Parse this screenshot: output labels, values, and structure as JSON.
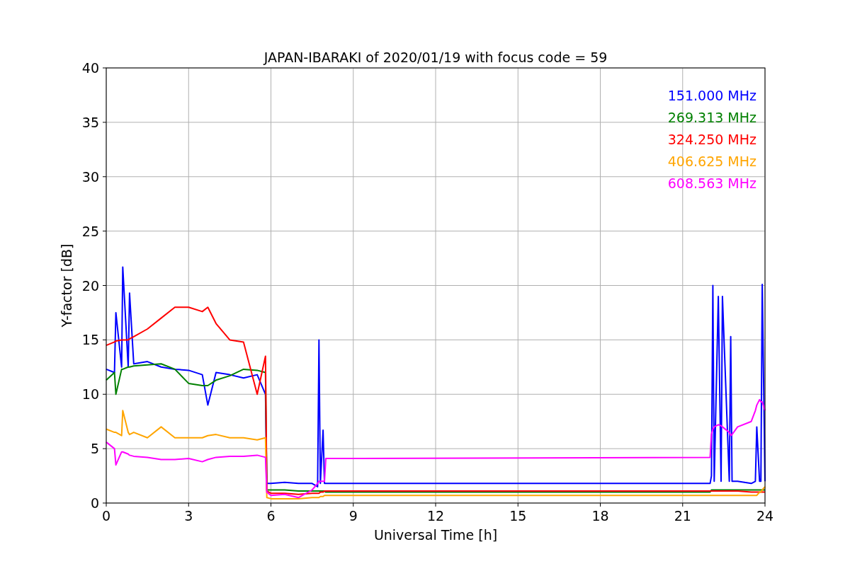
{
  "chart_data": {
    "type": "line",
    "title": "JAPAN-IBARAKI of 2020/01/19 with focus code = 59",
    "xlabel": "Universal Time [h]",
    "ylabel": "Y-factor [dB]",
    "x": [
      0,
      0.3,
      0.35,
      0.56,
      0.6,
      0.8,
      0.85,
      1,
      1.5,
      2,
      2.5,
      3,
      3.5,
      3.7,
      4,
      4.5,
      5,
      5.5,
      5.8,
      5.85,
      6,
      6.5,
      7,
      7.5,
      7.7,
      7.75,
      7.8,
      7.9,
      7.95,
      8,
      8.5,
      22,
      22.05,
      22.1,
      22.15,
      22.3,
      22.4,
      22.45,
      22.7,
      22.75,
      22.8,
      23,
      23.5,
      23.65,
      23.7,
      23.8,
      23.85,
      23.9,
      24
    ],
    "series": [
      {
        "name": "151.000 MHz",
        "color": "#0000ff",
        "values": [
          12.3,
          12,
          17.5,
          12.5,
          21.7,
          12.5,
          19.3,
          12.8,
          13,
          12.5,
          12.3,
          12.2,
          11.8,
          9,
          12,
          11.8,
          11.5,
          11.8,
          10,
          1.8,
          1.8,
          1.9,
          1.8,
          1.8,
          1.5,
          15,
          1.8,
          6.7,
          1.8,
          1.8,
          1.8,
          1.8,
          2.5,
          20,
          2,
          19,
          2,
          19,
          2,
          15.3,
          2,
          2,
          1.8,
          2,
          7,
          2,
          2,
          20.1,
          2
        ]
      },
      {
        "name": "269.313 MHz",
        "color": "#008000",
        "values": [
          11.3,
          12,
          10,
          12.3,
          12.3,
          12.5,
          12.5,
          12.6,
          12.7,
          12.8,
          12.3,
          11,
          10.8,
          10.8,
          11.3,
          11.7,
          12.3,
          12.2,
          12,
          1.2,
          1.2,
          1.2,
          1.1,
          1.1,
          1.1,
          1.1,
          1.1,
          1.1,
          1.1,
          1,
          1,
          1,
          1.2,
          1.2,
          1.2,
          1.2,
          1.2,
          1.2,
          1.2,
          1.2,
          1.2,
          1.2,
          1.2,
          1.2,
          1.2,
          1.2,
          1.2,
          1.2,
          1.2
        ]
      },
      {
        "name": "324.250 MHz",
        "color": "#ff0000",
        "values": [
          14.5,
          14.8,
          14.9,
          15,
          15,
          15,
          15.1,
          15.3,
          16,
          17,
          18,
          18,
          17.6,
          18,
          16.5,
          15,
          14.8,
          10,
          13.5,
          1.1,
          0.9,
          0.9,
          0.8,
          0.9,
          0.9,
          0.9,
          1,
          1,
          1.1,
          1.1,
          1.1,
          1.1,
          1.1,
          1.1,
          1.1,
          1.1,
          1.1,
          1.1,
          1.1,
          1.1,
          1.1,
          1.1,
          1,
          1,
          1,
          1,
          1,
          1,
          1
        ]
      },
      {
        "name": "406.625 MHz",
        "color": "#ffa500",
        "values": [
          6.8,
          6.5,
          6.5,
          6.2,
          8.5,
          6.5,
          6.3,
          6.5,
          6,
          7,
          6,
          6,
          6,
          6.2,
          6.3,
          6,
          6,
          5.8,
          6,
          0.5,
          0.4,
          0.4,
          0.4,
          0.5,
          0.5,
          0.5,
          0.6,
          0.6,
          0.7,
          0.7,
          0.7,
          0.7,
          0.7,
          0.7,
          0.7,
          0.7,
          0.7,
          0.7,
          0.7,
          0.7,
          0.7,
          0.7,
          0.7,
          0.7,
          0.7,
          1,
          1,
          1.2,
          1.5
        ]
      },
      {
        "name": "608.563 MHz",
        "color": "#ff00ff",
        "values": [
          5.6,
          5,
          3.5,
          4.7,
          4.7,
          4.5,
          4.4,
          4.3,
          4.2,
          4,
          4,
          4.1,
          3.8,
          4,
          4.2,
          4.3,
          4.3,
          4.4,
          4.2,
          1,
          0.7,
          0.8,
          0.5,
          1.2,
          1.8,
          2,
          2,
          2,
          2,
          4.1,
          4.1,
          4.2,
          6.3,
          6.8,
          7,
          7.2,
          7.1,
          7,
          6.5,
          6.2,
          6.3,
          7,
          7.5,
          8.5,
          9,
          9.5,
          9.3,
          9.3,
          8.5
        ]
      }
    ],
    "xlim": [
      0,
      24
    ],
    "ylim": [
      0,
      40
    ],
    "xticks": [
      0,
      3,
      6,
      9,
      12,
      15,
      18,
      21,
      24
    ],
    "yticks": [
      0,
      5,
      10,
      15,
      20,
      25,
      30,
      35,
      40
    ],
    "grid": true
  }
}
